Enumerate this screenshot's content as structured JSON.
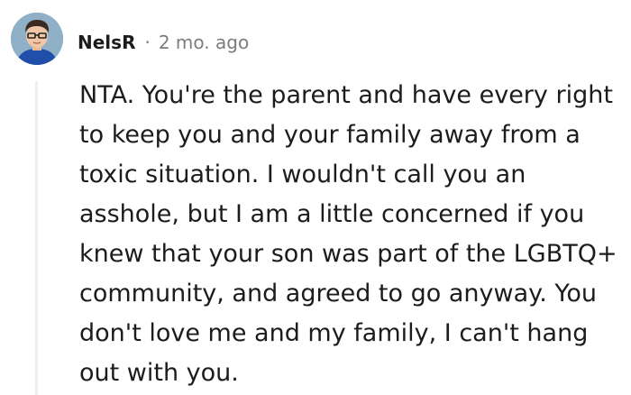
{
  "comment": {
    "author": "NelsR",
    "separator": "·",
    "timestamp": "2 mo. ago",
    "body": "NTA. You're the parent and have every right to keep you and your family away from a toxic situation. I wouldn't call you an asshole, but I am a little concerned if you knew that your son was part of the LGBTQ+ community, and agreed to go anyway. You don't love me and my family, I can't hang out with you."
  },
  "colors": {
    "text": "#1c1c1c",
    "muted": "#7c7c7c",
    "thread_line": "#edeff1",
    "avatar_bg": "#8fb0c6"
  },
  "icons": {
    "avatar": "user-avatar"
  }
}
